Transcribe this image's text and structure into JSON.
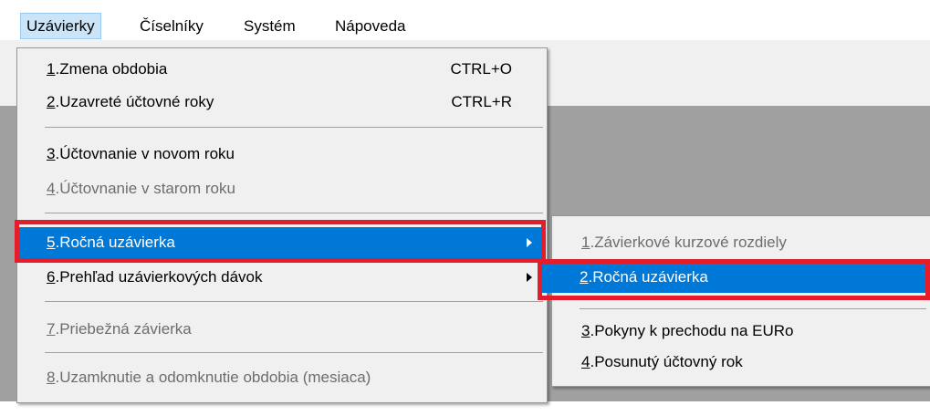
{
  "menubar": {
    "items": [
      {
        "label": "Uzávierky"
      },
      {
        "label": "Číselníky"
      },
      {
        "label": "Systém"
      },
      {
        "label": "Nápoveda"
      }
    ]
  },
  "main_menu": {
    "items": [
      {
        "num": "1",
        "label": ".Zmena obdobia",
        "shortcut": "CTRL+O"
      },
      {
        "num": "2",
        "label": ".Uzavreté účtovné roky",
        "shortcut": "CTRL+R"
      },
      {
        "num": "3",
        "label": ".Účtovnanie v novom roku"
      },
      {
        "num": "4",
        "label": ".Účtovnanie v starom roku"
      },
      {
        "num": "5",
        "label": ".Ročná uzávierka"
      },
      {
        "num": "6",
        "label": ".Prehľad  uzávierkových dávok"
      },
      {
        "num": "7",
        "label": ".Priebežná závierka"
      },
      {
        "num": "8",
        "label": ".Uzamknutie a odomknutie obdobia (mesiaca)"
      }
    ]
  },
  "submenu": {
    "items": [
      {
        "num": "1",
        "label": ".Závierkové kurzové rozdiely"
      },
      {
        "num": "2",
        "label": ".Ročná uzávierka"
      },
      {
        "num": "3",
        "label": ".Pokyny k prechodu na EURo"
      },
      {
        "num": "4",
        "label": ".Posunutý účtovný rok"
      }
    ]
  },
  "colors": {
    "highlight": "#0078d7",
    "annotation_red": "#e51d2a",
    "workspace": "#a0a0a0",
    "menu_bg": "#f0f0f0"
  }
}
